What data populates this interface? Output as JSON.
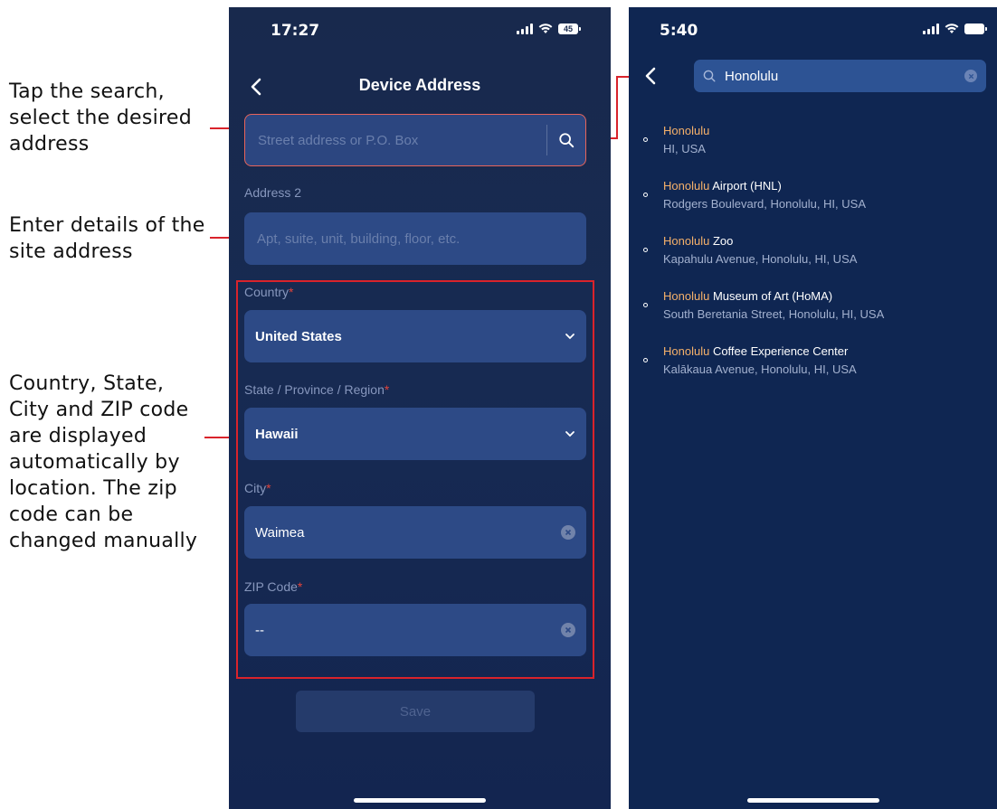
{
  "annotations": {
    "search_note": "Tap the search, select the desired address",
    "details_note": "Enter details of the site address",
    "auto_note": "Country, State, City and ZIP code are displayed automatically by location. The zip code can be changed manually"
  },
  "left_phone": {
    "status": {
      "time": "17:27",
      "battery": "45"
    },
    "title": "Device Address",
    "search": {
      "placeholder": "Street address or P.O. Box"
    },
    "address2": {
      "label": "Address 2",
      "placeholder": "Apt, suite, unit, building, floor, etc."
    },
    "country": {
      "label": "Country",
      "required": "*",
      "value": "United States"
    },
    "state": {
      "label": "State / Province / Region",
      "required": "*",
      "value": "Hawaii"
    },
    "city": {
      "label": "City",
      "required": "*",
      "value": "Waimea"
    },
    "zip": {
      "label": "ZIP Code",
      "required": "*",
      "value": "--"
    },
    "save_label": "Save"
  },
  "right_phone": {
    "status": {
      "time": "5:40"
    },
    "search_value": "Honolulu",
    "results": [
      {
        "highlight": "Honolulu",
        "rest": "",
        "subtitle": "HI, USA"
      },
      {
        "highlight": "Honolulu",
        "rest": " Airport (HNL)",
        "subtitle": "Rodgers Boulevard, Honolulu, HI, USA"
      },
      {
        "highlight": "Honolulu",
        "rest": " Zoo",
        "subtitle": "Kapahulu Avenue, Honolulu, HI, USA"
      },
      {
        "highlight": "Honolulu",
        "rest": " Museum of Art (HoMA)",
        "subtitle": "South Beretania Street, Honolulu, HI, USA"
      },
      {
        "highlight": "Honolulu",
        "rest": " Coffee Experience Center",
        "subtitle": "Kalākaua Avenue, Honolulu, HI, USA"
      }
    ]
  },
  "colors": {
    "annotation_red": "#d9232b",
    "background_navy": "#18294d",
    "field_blue": "#2d4a86",
    "highlight_orange": "#f5b06a",
    "required_red": "#e0433a"
  },
  "icons": [
    "back-chevron-icon",
    "search-icon",
    "dropdown-chevron-icon",
    "clear-icon",
    "signal-icon",
    "wifi-icon",
    "battery-icon",
    "result-dot-icon"
  ]
}
